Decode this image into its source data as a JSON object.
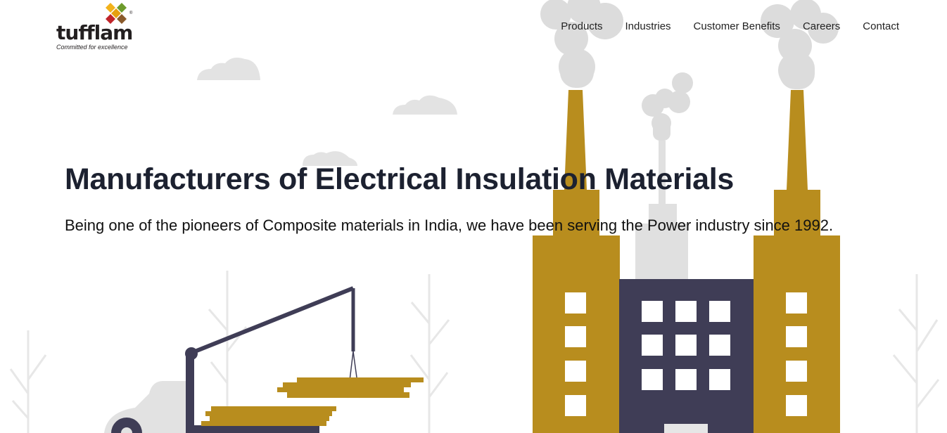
{
  "brand": {
    "name": "tufflam",
    "tagline": "Committed for excellence",
    "registered_mark": "®",
    "colors": {
      "diamond_top": "#f2b21b",
      "diamond_left": "#e6a010",
      "diamond_right": "#6d9b2c",
      "diamond_bottom_left": "#c0242a",
      "diamond_bottom_right": "#8a5a2b"
    }
  },
  "nav": {
    "items": [
      {
        "label": "Products"
      },
      {
        "label": "Industries"
      },
      {
        "label": "Customer Benefits"
      },
      {
        "label": "Careers"
      },
      {
        "label": "Contact"
      }
    ]
  },
  "hero": {
    "title": "Manufacturers of Electrical Insulation Materials",
    "subtitle": "Being one of the pioneers of Composite materials in India, we have been serving the Power industry since 1992."
  },
  "theme": {
    "factory_gold": "#b88d1e",
    "factory_dark": "#3f3d56",
    "smoke_gray": "#e0e0e0",
    "window_white": "#ffffff"
  }
}
